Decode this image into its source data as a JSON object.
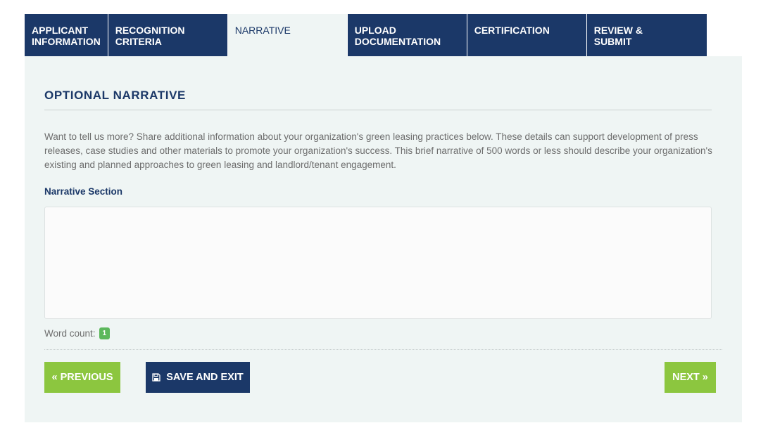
{
  "tabs": [
    {
      "label": "APPLICANT\nINFORMATION",
      "active": false
    },
    {
      "label": "RECOGNITION\nCRITERIA",
      "active": false
    },
    {
      "label": "NARRATIVE",
      "active": true
    },
    {
      "label": "UPLOAD\nDOCUMENTATION",
      "active": false
    },
    {
      "label": "CERTIFICATION",
      "active": false
    },
    {
      "label": "REVIEW &\nSUBMIT",
      "active": false
    }
  ],
  "section": {
    "title": "OPTIONAL NARRATIVE",
    "intro": "Want to tell us more? Share additional information about your organization's green leasing practices below. These details can support development of press releases, case studies and other materials to promote your organization's success. This brief narrative of 500 words or less should describe your organization's existing and planned approaches to green leasing and landlord/tenant engagement.",
    "field_label": "Narrative Section",
    "field_value": "",
    "word_count_label": "Word count:",
    "word_count": "1"
  },
  "buttons": {
    "previous": "« PREVIOUS",
    "save_exit": "SAVE AND EXIT",
    "next": "NEXT »"
  },
  "icons": {
    "save": "floppy-disk-icon"
  },
  "colors": {
    "navy": "#1b3868",
    "green": "#8cc63f",
    "panel": "#eff5f4",
    "badge": "#5cb85c"
  }
}
